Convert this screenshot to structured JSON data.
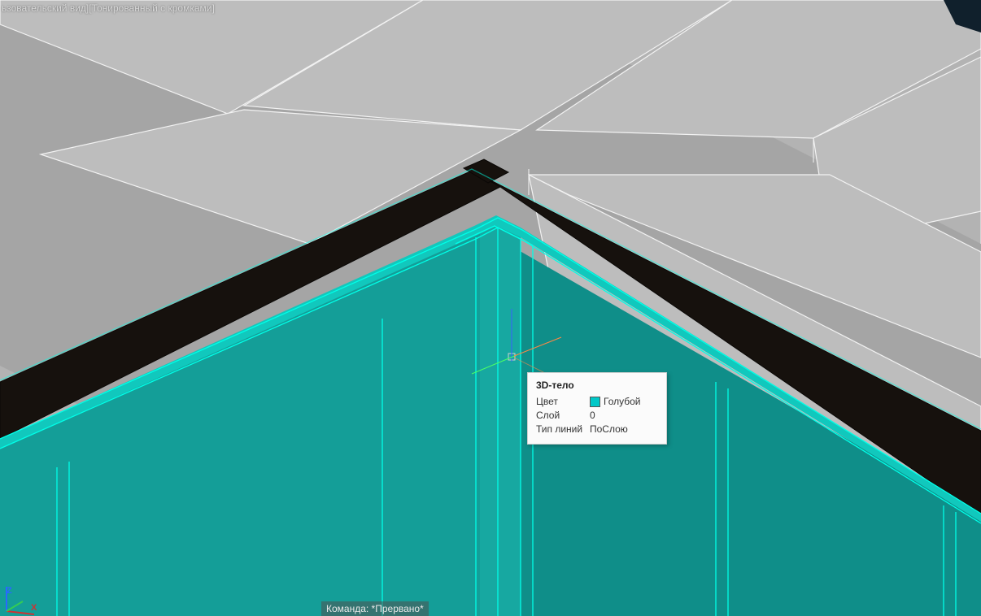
{
  "view_label": "ьзовательский вид][Тонированный с кромками]",
  "tooltip": {
    "title": "3D-тело",
    "color_label": "Цвет",
    "color_value": "Голубой",
    "layer_label": "Слой",
    "layer_value": "0",
    "linetype_label": "Тип линий",
    "linetype_value": "ПоСлою"
  },
  "command_line": "Команда:  *Прервано*",
  "axes": {
    "z": "Z",
    "x": "X"
  },
  "colors": {
    "cyan_face": "#15a6a0",
    "cyan_edge": "#00fff2",
    "frame_dark": "#14100d",
    "slab_light": "#bcbcbc",
    "slab_mid": "#a5a5a5",
    "slab_edge": "#f5f5f5"
  }
}
